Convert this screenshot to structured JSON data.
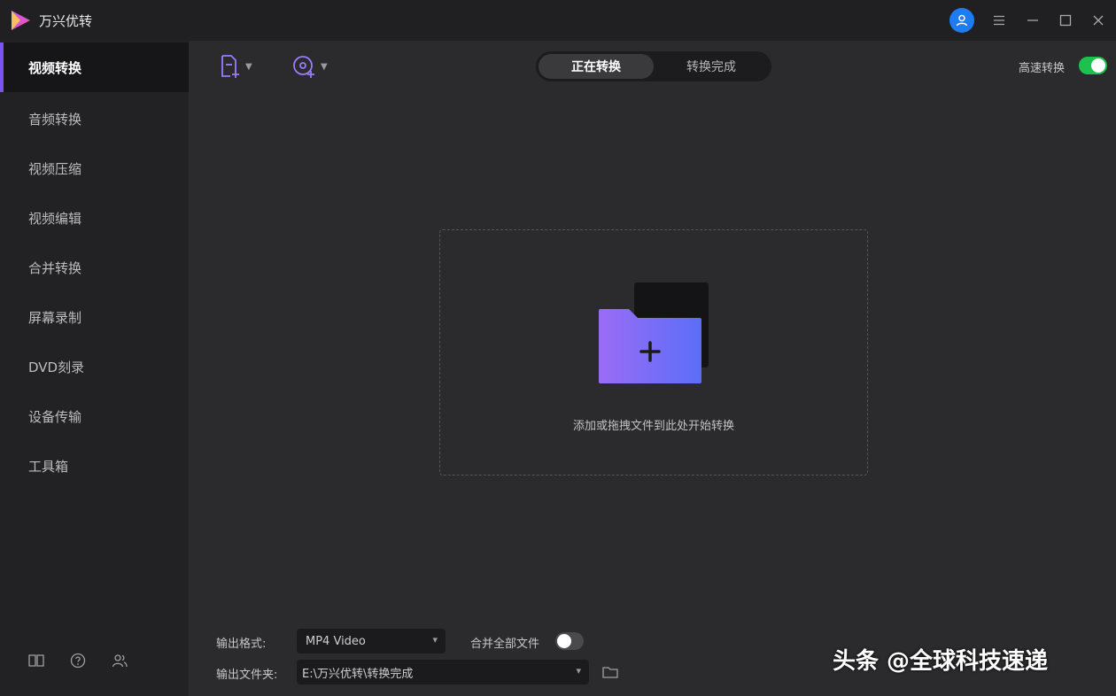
{
  "app": {
    "title": "万兴优转"
  },
  "sidebar": {
    "items": [
      {
        "label": "视频转换",
        "active": true
      },
      {
        "label": "音频转换"
      },
      {
        "label": "视频压缩"
      },
      {
        "label": "视频编辑"
      },
      {
        "label": "合并转换"
      },
      {
        "label": "屏幕录制"
      },
      {
        "label": "DVD刻录"
      },
      {
        "label": "设备传输"
      },
      {
        "label": "工具箱"
      }
    ],
    "footer_icons": [
      "book-icon",
      "help-icon",
      "user-group-icon"
    ]
  },
  "toolbar": {
    "add_file_icon": "add-file-icon",
    "add_disc_icon": "add-disc-icon"
  },
  "tabs": [
    {
      "label": "正在转换",
      "active": true
    },
    {
      "label": "转换完成"
    }
  ],
  "fast_convert": {
    "label": "高速转换",
    "enabled": true
  },
  "dropzone": {
    "hint": "添加或拖拽文件到此处开始转换"
  },
  "output": {
    "format_label": "输出格式:",
    "format_value": "MP4 Video",
    "merge_label": "合并全部文件",
    "merge_enabled": false,
    "folder_label": "输出文件夹:",
    "folder_value": "E:\\万兴优转\\转换完成"
  },
  "watermark": "头条 @全球科技速递",
  "colors": {
    "accent": "#7b52f5",
    "toggle_on": "#1cc24d",
    "avatar": "#1e7cf2"
  }
}
